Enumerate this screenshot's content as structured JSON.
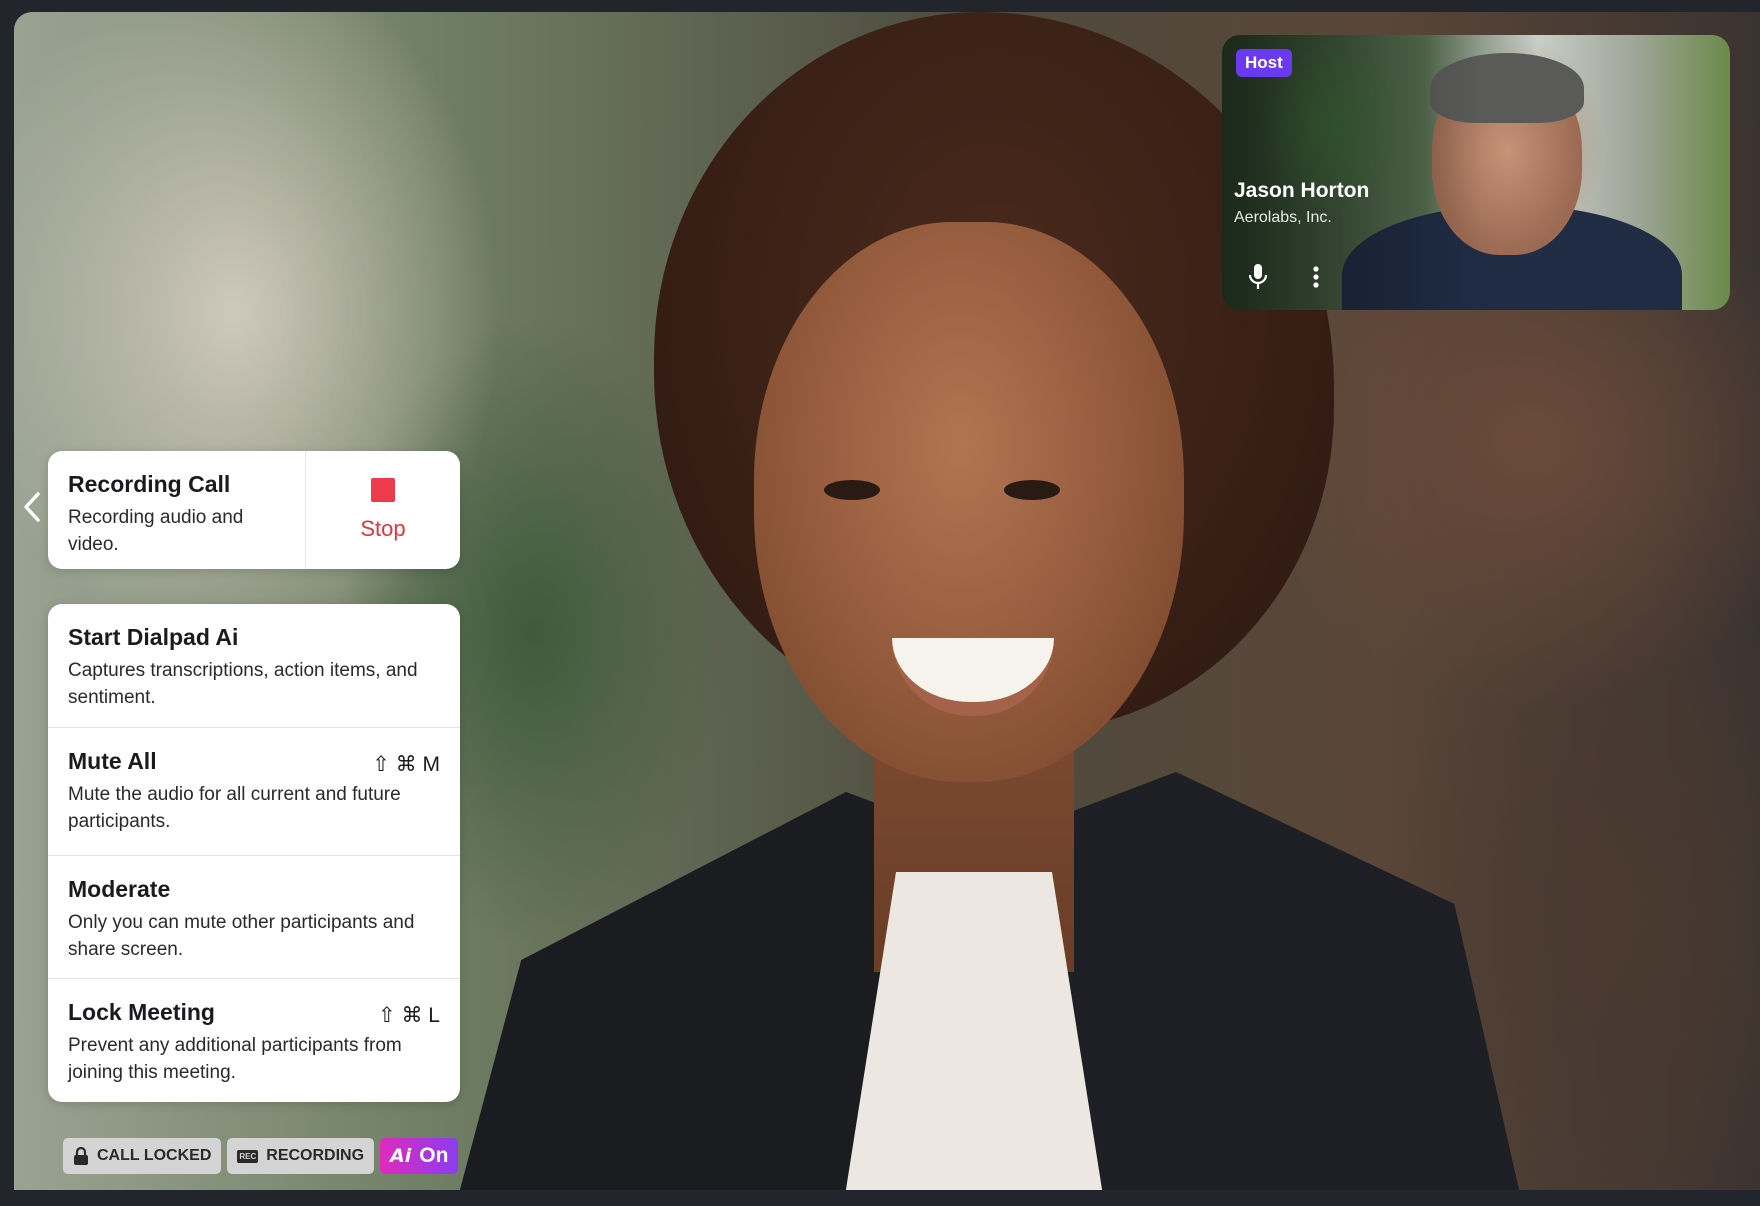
{
  "participant": {
    "badge": "Host",
    "name": "Jason Horton",
    "company": "Aerolabs, Inc.",
    "icons": [
      "microphone-icon",
      "more-vertical-icon"
    ]
  },
  "recording_card": {
    "title": "Recording Call",
    "subtitle": "Recording audio and video.",
    "stop_label": "Stop",
    "stop_color": "#ec3b4a"
  },
  "menu": {
    "items": [
      {
        "title": "Start Dialpad Ai",
        "description": "Captures transcriptions, action items, and sentiment.",
        "shortcut": ""
      },
      {
        "title": "Mute All",
        "description": "Mute the audio for all current and future participants.",
        "shortcut": "⇧ ⌘ M"
      },
      {
        "title": "Moderate",
        "description": "Only you can mute other participants and share screen.",
        "shortcut": ""
      },
      {
        "title": "Lock Meeting",
        "description": "Prevent any additional participants from joining this meeting.",
        "shortcut": "⇧ ⌘ L"
      }
    ]
  },
  "status": {
    "locked": "CALL LOCKED",
    "recording": "RECORDING",
    "rec_tag": "REC",
    "ai": "On",
    "ai_logo": "Ai"
  },
  "colors": {
    "host_badge": "#6a39f0",
    "ai_gradient_start": "#e02bbd",
    "ai_gradient_end": "#8a3cf0"
  }
}
